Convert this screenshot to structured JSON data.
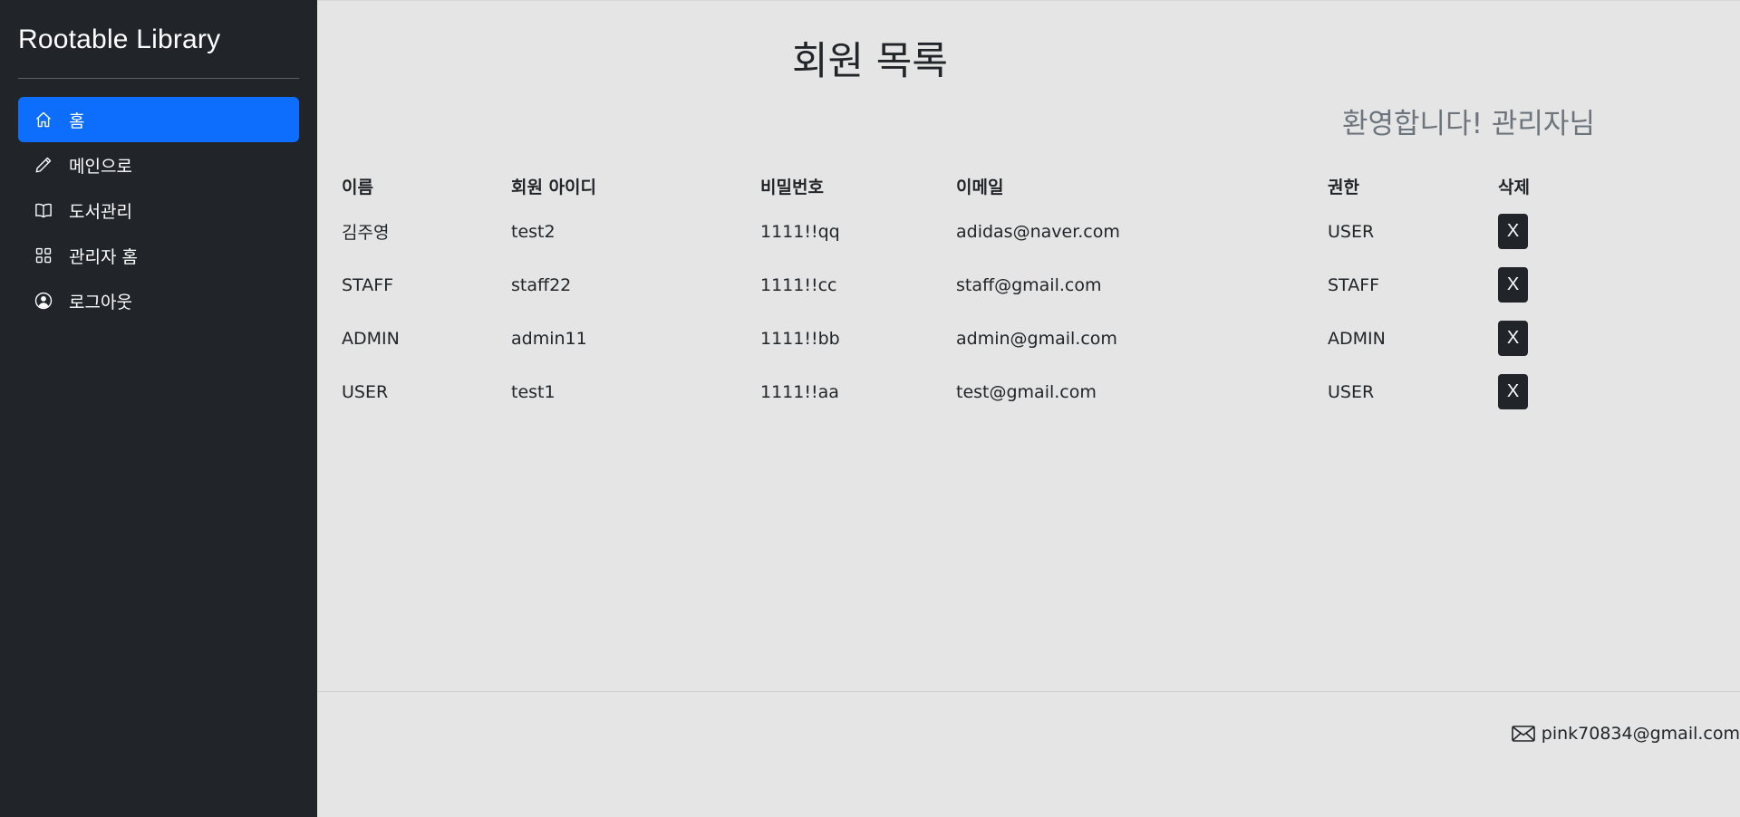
{
  "sidebar": {
    "brand": "Rootable Library",
    "items": [
      {
        "label": "홈",
        "icon": "home-icon",
        "active": true
      },
      {
        "label": "메인으로",
        "icon": "pencil-icon",
        "active": false
      },
      {
        "label": "도서관리",
        "icon": "book-icon",
        "active": false
      },
      {
        "label": "관리자 홈",
        "icon": "grid-icon",
        "active": false
      },
      {
        "label": "로그아웃",
        "icon": "user-circle-icon",
        "active": false
      }
    ]
  },
  "main": {
    "title": "회원 목록",
    "welcome": "환영합니다! 관리자님",
    "table": {
      "headers": [
        "이름",
        "회원 아이디",
        "비밀번호",
        "이메일",
        "권한",
        "삭제"
      ],
      "rows": [
        {
          "name": "김주영",
          "id": "test2",
          "password": "1111!!qq",
          "email": "adidas@naver.com",
          "role": "USER",
          "delete": "X"
        },
        {
          "name": "STAFF",
          "id": "staff22",
          "password": "1111!!cc",
          "email": "staff@gmail.com",
          "role": "STAFF",
          "delete": "X"
        },
        {
          "name": "ADMIN",
          "id": "admin11",
          "password": "1111!!bb",
          "email": "admin@gmail.com",
          "role": "ADMIN",
          "delete": "X"
        },
        {
          "name": "USER",
          "id": "test1",
          "password": "1111!!aa",
          "email": "test@gmail.com",
          "role": "USER",
          "delete": "X"
        }
      ]
    }
  },
  "footer": {
    "email": "pink70834@gmail.com",
    "icon": "envelope-icon"
  },
  "colors": {
    "sidebar_bg": "#212529",
    "accent": "#0d6efd",
    "page_bg": "#e5e5e5",
    "welcome_text": "#6c757d"
  }
}
